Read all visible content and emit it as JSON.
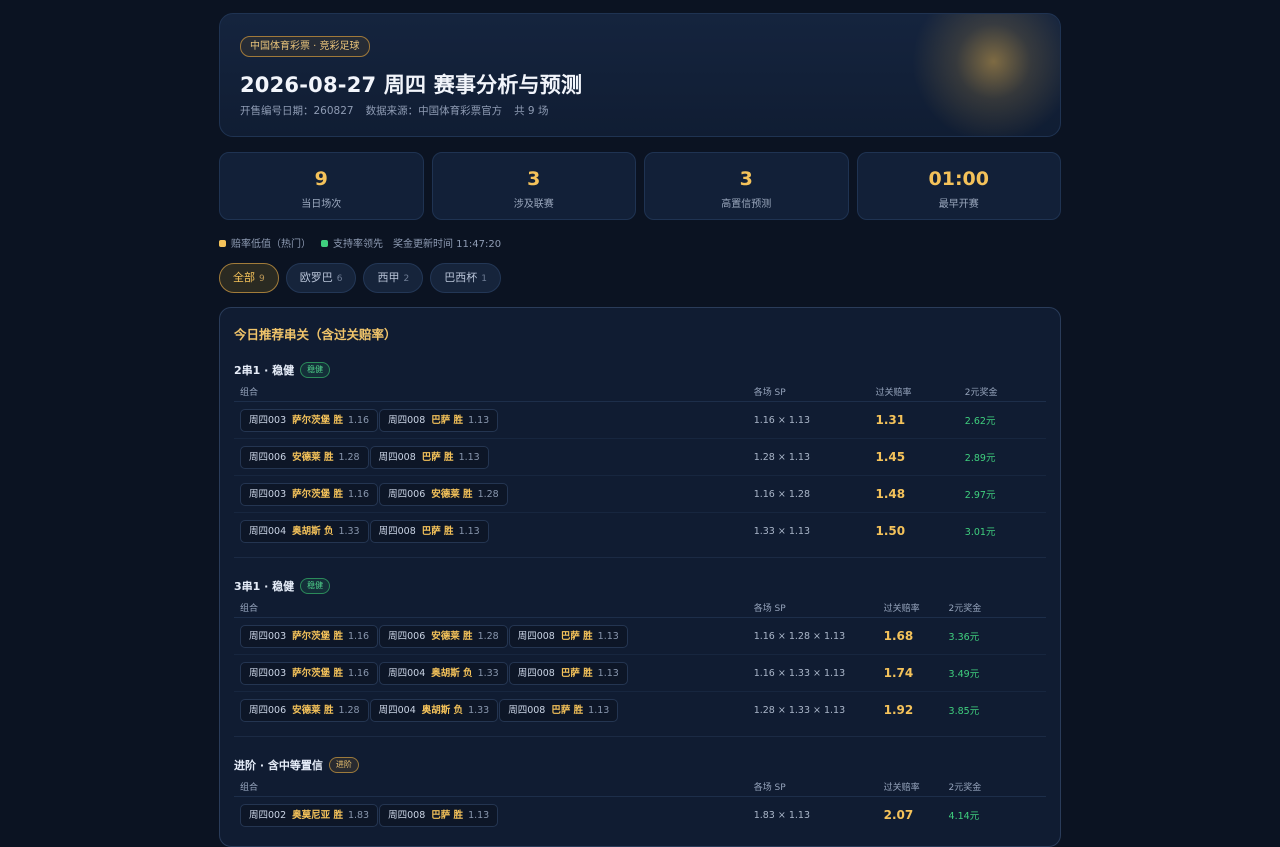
{
  "header": {
    "pill": "中国体育彩票 · 竞彩足球",
    "title": "2026-08-27 周四 赛事分析与预测",
    "meta": [
      "开售编号日期：260827",
      "数据来源：中国体育彩票官方",
      "共 9 场"
    ]
  },
  "stats": [
    {
      "value": "9",
      "label": "当日场次"
    },
    {
      "value": "3",
      "label": "涉及联赛"
    },
    {
      "value": "3",
      "label": "高置信预测"
    },
    {
      "value": "01:00",
      "label": "最早开赛"
    }
  ],
  "legend": {
    "low_odds": "赔率低值（热门）",
    "support": "支持率领先",
    "updated": "奖金更新时间 11:47:20",
    "colors": {
      "low_odds": "#f4c25a",
      "support": "#3fcf7e"
    }
  },
  "tabs": [
    {
      "label": "全部",
      "count": "9"
    },
    {
      "label": "欧罗巴",
      "count": "6"
    },
    {
      "label": "西甲",
      "count": "2"
    },
    {
      "label": "巴西杯",
      "count": "1"
    }
  ],
  "panel_title": "今日推荐串关（含过关赔率）",
  "columns": {
    "combo": "组合",
    "sp": "各场 SP",
    "rate": "过关赔率",
    "prize": "2元奖金"
  },
  "sections": [
    {
      "title": "2串1 · 稳健",
      "badge": "稳健",
      "badge_type": "green",
      "rows": [
        {
          "legs": [
            {
              "match": "周四003",
              "pick": "萨尔茨堡 胜",
              "sp": "1.16"
            },
            {
              "match": "周四008",
              "pick": "巴萨 胜",
              "sp": "1.13"
            }
          ],
          "sp": "1.16 × 1.13",
          "rate": "1.31",
          "prize": "2.62元"
        },
        {
          "legs": [
            {
              "match": "周四006",
              "pick": "安德莱 胜",
              "sp": "1.28"
            },
            {
              "match": "周四008",
              "pick": "巴萨 胜",
              "sp": "1.13"
            }
          ],
          "sp": "1.28 × 1.13",
          "rate": "1.45",
          "prize": "2.89元"
        },
        {
          "legs": [
            {
              "match": "周四003",
              "pick": "萨尔茨堡 胜",
              "sp": "1.16"
            },
            {
              "match": "周四006",
              "pick": "安德莱 胜",
              "sp": "1.28"
            }
          ],
          "sp": "1.16 × 1.28",
          "rate": "1.48",
          "prize": "2.97元"
        },
        {
          "legs": [
            {
              "match": "周四004",
              "pick": "奥胡斯 负",
              "sp": "1.33"
            },
            {
              "match": "周四008",
              "pick": "巴萨 胜",
              "sp": "1.13"
            }
          ],
          "sp": "1.33 × 1.13",
          "rate": "1.50",
          "prize": "3.01元"
        }
      ]
    },
    {
      "title": "3串1 · 稳健",
      "badge": "稳健",
      "badge_type": "green",
      "rows": [
        {
          "legs": [
            {
              "match": "周四003",
              "pick": "萨尔茨堡 胜",
              "sp": "1.16"
            },
            {
              "match": "周四006",
              "pick": "安德莱 胜",
              "sp": "1.28"
            },
            {
              "match": "周四008",
              "pick": "巴萨 胜",
              "sp": "1.13"
            }
          ],
          "sp": "1.16 × 1.28 × 1.13",
          "rate": "1.68",
          "prize": "3.36元"
        },
        {
          "legs": [
            {
              "match": "周四003",
              "pick": "萨尔茨堡 胜",
              "sp": "1.16"
            },
            {
              "match": "周四004",
              "pick": "奥胡斯 负",
              "sp": "1.33"
            },
            {
              "match": "周四008",
              "pick": "巴萨 胜",
              "sp": "1.13"
            }
          ],
          "sp": "1.16 × 1.33 × 1.13",
          "rate": "1.74",
          "prize": "3.49元"
        },
        {
          "legs": [
            {
              "match": "周四006",
              "pick": "安德莱 胜",
              "sp": "1.28"
            },
            {
              "match": "周四004",
              "pick": "奥胡斯 负",
              "sp": "1.33"
            },
            {
              "match": "周四008",
              "pick": "巴萨 胜",
              "sp": "1.13"
            }
          ],
          "sp": "1.28 × 1.33 × 1.13",
          "rate": "1.92",
          "prize": "3.85元"
        }
      ]
    },
    {
      "title": "进阶 · 含中等置信",
      "badge": "进阶",
      "badge_type": "gold",
      "rows": [
        {
          "legs": [
            {
              "match": "周四002",
              "pick": "奥莫尼亚 胜",
              "sp": "1.83"
            },
            {
              "match": "周四008",
              "pick": "巴萨 胜",
              "sp": "1.13"
            }
          ],
          "sp": "1.83 × 1.13",
          "rate": "2.07",
          "prize": "4.14元"
        }
      ]
    }
  ]
}
